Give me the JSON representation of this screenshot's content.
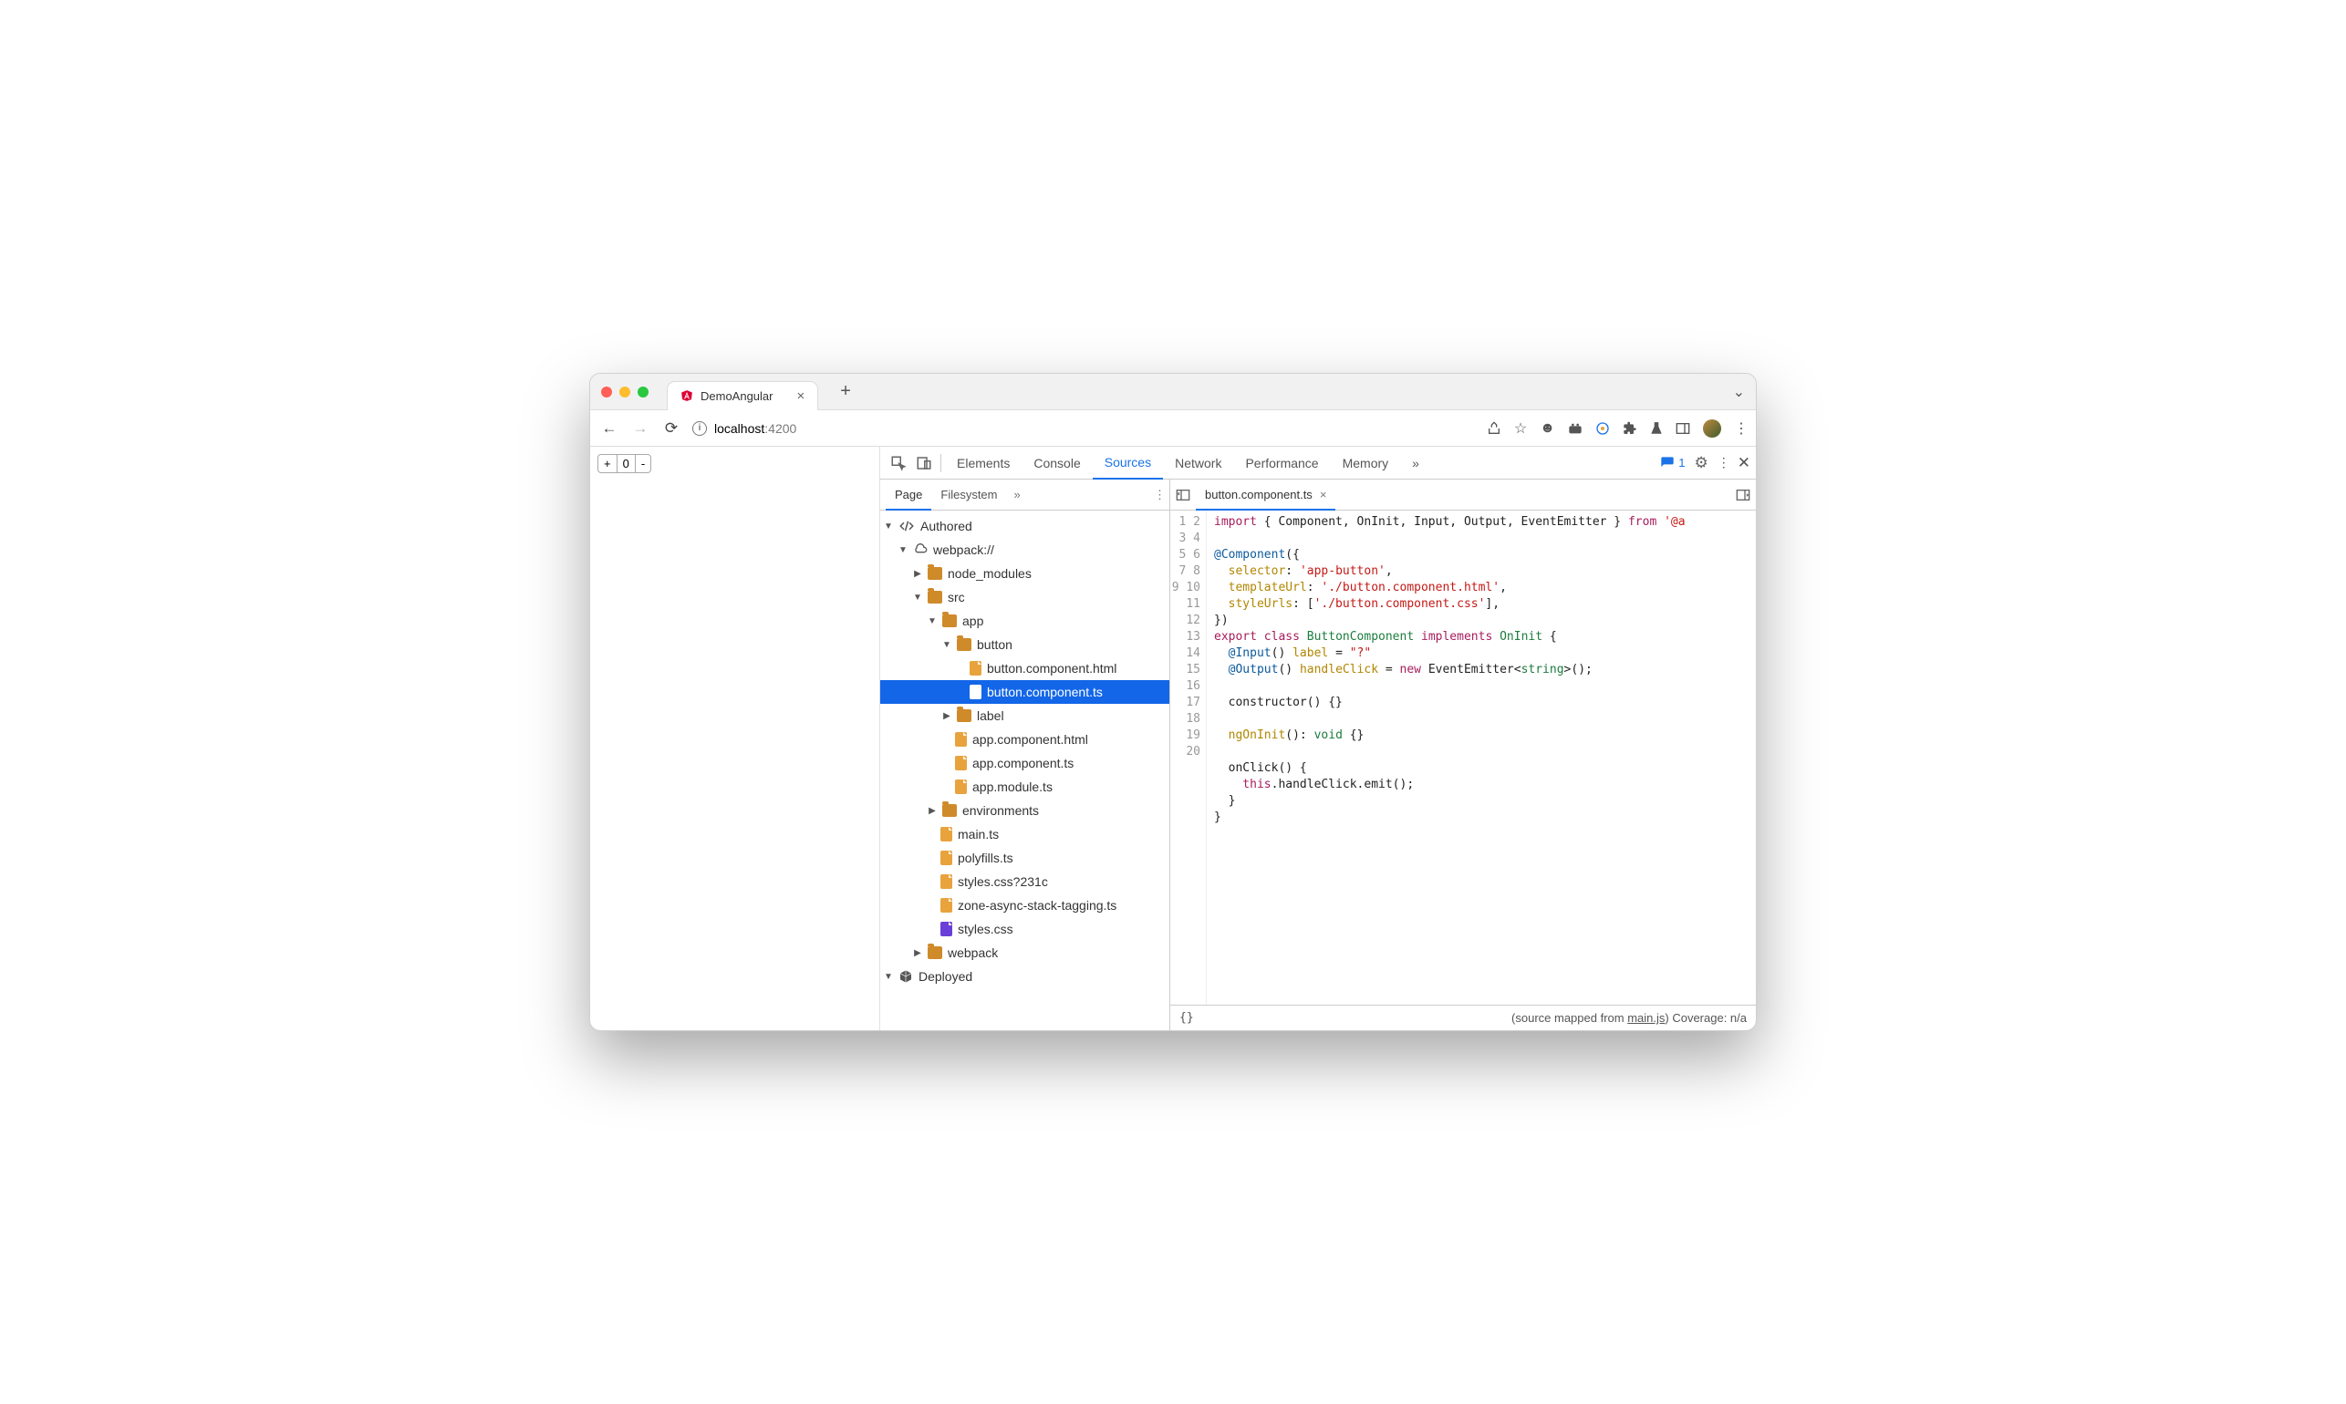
{
  "browser": {
    "tab_title": "DemoAngular",
    "url_host": "localhost",
    "url_port": ":4200"
  },
  "page": {
    "counter_plus": "+",
    "counter_val": "0",
    "counter_minus": "-"
  },
  "devtools": {
    "tabs": [
      "Elements",
      "Console",
      "Sources",
      "Network",
      "Performance",
      "Memory"
    ],
    "active_tab": "Sources",
    "issues_count": "1",
    "nav_tabs": [
      "Page",
      "Filesystem"
    ],
    "open_file": "button.component.ts",
    "tree": {
      "authored": "Authored",
      "webpack": "webpack://",
      "node_modules": "node_modules",
      "src": "src",
      "app": "app",
      "button_dir": "button",
      "btn_html": "button.component.html",
      "btn_ts": "button.component.ts",
      "label": "label",
      "app_html": "app.component.html",
      "app_ts": "app.component.ts",
      "app_mod": "app.module.ts",
      "environments": "environments",
      "main": "main.ts",
      "polyfills": "polyfills.ts",
      "styles_q": "styles.css?231c",
      "zone": "zone-async-stack-tagging.ts",
      "styles": "styles.css",
      "webpack_dir": "webpack",
      "deployed": "Deployed"
    },
    "status_mapped": "(source mapped from ",
    "status_mapped_link": "main.js",
    "status_cov": ")  Coverage: n/a",
    "pretty": "{}"
  },
  "code": {
    "lines": 20,
    "l1a": "import",
    "l1b": " { Component, OnInit, Input, Output, EventEmitter } ",
    "l1c": "from",
    "l1d": " '@a",
    "l3a": "@Component",
    "l3b": "({",
    "l4a": "  selector",
    "l4b": ": ",
    "l4c": "'app-button'",
    "l4d": ",",
    "l5a": "  templateUrl",
    "l5b": ": ",
    "l5c": "'./button.component.html'",
    "l5d": ",",
    "l6a": "  styleUrls",
    "l6b": ": [",
    "l6c": "'./button.component.css'",
    "l6d": "],",
    "l7": "})",
    "l8a": "export",
    "l8b": " class ",
    "l8c": "ButtonComponent",
    "l8d": " implements ",
    "l8e": "OnInit",
    "l8f": " {",
    "l9a": "  @Input",
    "l9b": "() ",
    "l9c": "label",
    "l9d": " = ",
    "l9e": "\"?\"",
    "l10a": "  @Output",
    "l10b": "() ",
    "l10c": "handleClick",
    "l10d": " = ",
    "l10e": "new",
    "l10f": " EventEmitter<",
    "l10g": "string",
    "l10h": ">();",
    "l12": "  constructor() {}",
    "l14a": "  ngOnInit",
    "l14b": "(): ",
    "l14c": "void",
    "l14d": " {}",
    "l16": "  onClick() {",
    "l17a": "    this",
    "l17b": ".handleClick.emit();",
    "l18": "  }",
    "l19": "}"
  }
}
